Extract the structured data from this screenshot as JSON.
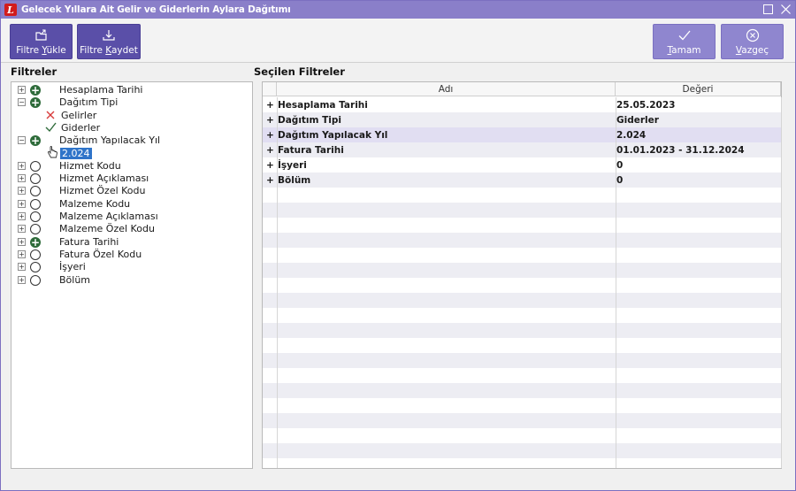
{
  "window": {
    "title": "Gelecek Yıllara Ait Gelir ve Giderlerin Aylara Dağıtımı",
    "logo_letter": "L",
    "accent": "#8a7fc9"
  },
  "toolbar": {
    "load_pre": "Filtre ",
    "load_key": "Y",
    "load_post": "ükle",
    "save_pre": "Filtre ",
    "save_key": "K",
    "save_post": "aydet",
    "ok_key": "T",
    "ok_post": "amam",
    "cancel_key": "V",
    "cancel_post": "azgeç"
  },
  "filters_title": "Filtreler",
  "selected_title": "Seçilen Filtreler",
  "tree": [
    {
      "label": "Hesaplama Tarihi",
      "expander": "+",
      "status": "plus"
    },
    {
      "label": "Dağıtım Tipi",
      "expander": "−",
      "status": "plus"
    },
    {
      "label": "Gelirler",
      "child": true,
      "mark": "x"
    },
    {
      "label": "Giderler",
      "child": true,
      "mark": "check"
    },
    {
      "label": "Dağıtım Yapılacak Yıl",
      "expander": "−",
      "status": "plus"
    },
    {
      "label": "2.024",
      "child": true,
      "mark": "hand",
      "selected": true
    },
    {
      "label": "Hizmet Kodu",
      "expander": "+",
      "status": "empty"
    },
    {
      "label": "Hizmet Açıklaması",
      "expander": "+",
      "status": "empty"
    },
    {
      "label": "Hizmet Özel Kodu",
      "expander": "+",
      "status": "empty"
    },
    {
      "label": "Malzeme Kodu",
      "expander": "+",
      "status": "empty"
    },
    {
      "label": "Malzeme Açıklaması",
      "expander": "+",
      "status": "empty"
    },
    {
      "label": "Malzeme Özel Kodu",
      "expander": "+",
      "status": "empty"
    },
    {
      "label": "Fatura Tarihi",
      "expander": "+",
      "status": "plus"
    },
    {
      "label": "Fatura Özel Kodu",
      "expander": "+",
      "status": "empty"
    },
    {
      "label": "İşyeri",
      "expander": "+",
      "status": "empty"
    },
    {
      "label": "Bölüm",
      "expander": "+",
      "status": "empty"
    }
  ],
  "grid": {
    "col_name": "Adı",
    "col_value": "Değeri",
    "rows": [
      {
        "prefix": "+",
        "name": "Hesaplama Tarihi",
        "value": "25.05.2023"
      },
      {
        "prefix": "+",
        "name": "Dağıtım Tipi",
        "value": "Giderler"
      },
      {
        "prefix": "+",
        "name": "Dağıtım Yapılacak Yıl",
        "value": "2.024"
      },
      {
        "prefix": "+",
        "name": "Fatura Tarihi",
        "value": "01.01.2023 - 31.12.2024"
      },
      {
        "prefix": "+",
        "name": "İşyeri",
        "value": "0"
      },
      {
        "prefix": "+",
        "name": "Bölüm",
        "value": "0"
      }
    ]
  }
}
